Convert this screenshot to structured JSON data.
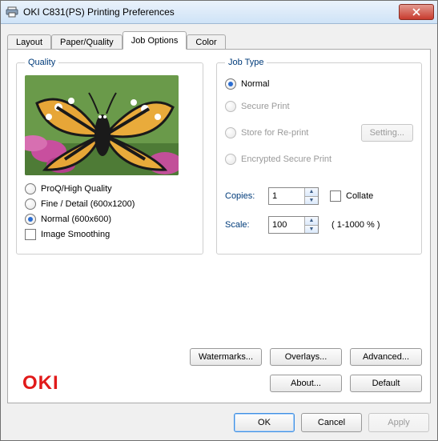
{
  "window": {
    "title": "OKI C831(PS) Printing Preferences"
  },
  "tabs": {
    "layout": "Layout",
    "paper_quality": "Paper/Quality",
    "job_options": "Job Options",
    "color": "Color"
  },
  "quality": {
    "legend": "Quality",
    "options": {
      "proq": "ProQ/High Quality",
      "fine": "Fine / Detail (600x1200)",
      "normal": "Normal (600x600)"
    },
    "image_smoothing": "Image Smoothing"
  },
  "jobtype": {
    "legend": "Job Type",
    "options": {
      "normal": "Normal",
      "secure": "Secure Print",
      "store": "Store for Re-print",
      "encrypted": "Encrypted Secure Print"
    },
    "setting_button": "Setting...",
    "copies_label": "Copies:",
    "copies_value": "1",
    "collate_label": "Collate",
    "scale_label": "Scale:",
    "scale_value": "100",
    "scale_range": "( 1-1000 % )"
  },
  "buttons": {
    "watermarks": "Watermarks...",
    "overlays": "Overlays...",
    "advanced": "Advanced...",
    "about": "About...",
    "default": "Default"
  },
  "brand": "OKI",
  "dialog": {
    "ok": "OK",
    "cancel": "Cancel",
    "apply": "Apply"
  }
}
